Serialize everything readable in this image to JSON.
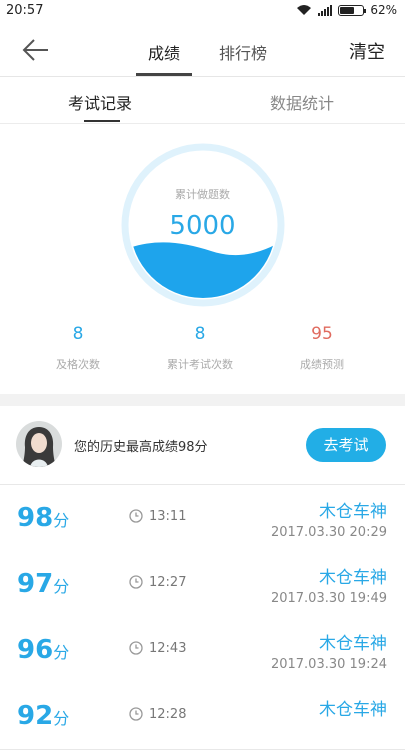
{
  "status_bar": {
    "time": "20:57",
    "battery": "62%",
    "battery_level": 0.62
  },
  "header": {
    "tabs": [
      {
        "label": "成绩"
      },
      {
        "label": "排行榜"
      }
    ],
    "clear_label": "清空"
  },
  "sub_tabs": [
    {
      "label": "考试记录"
    },
    {
      "label": "数据统计"
    }
  ],
  "gauge": {
    "label": "累计做题数",
    "value": "5000"
  },
  "stats": [
    {
      "value": "8",
      "label": "及格次数"
    },
    {
      "value": "8",
      "label": "累计考试次数"
    },
    {
      "value": "95",
      "label": "成绩预测"
    }
  ],
  "best": {
    "text": "您的历史最高成绩98分",
    "button_label": "去考试"
  },
  "score_unit": "分",
  "records": [
    {
      "score": "98",
      "duration": "13:11",
      "name": "木仓车神",
      "date": "2017.03.30  20:29"
    },
    {
      "score": "97",
      "duration": "12:27",
      "name": "木仓车神",
      "date": "2017.03.30  19:49"
    },
    {
      "score": "96",
      "duration": "12:43",
      "name": "木仓车神",
      "date": "2017.03.30  19:24"
    },
    {
      "score": "92",
      "duration": "12:28",
      "name": "木仓车神",
      "date": ""
    }
  ],
  "colors": {
    "accent": "#29a8e6",
    "button": "#22aee6",
    "prediction": "#e06b5f",
    "wave": "#1ea4ec"
  }
}
